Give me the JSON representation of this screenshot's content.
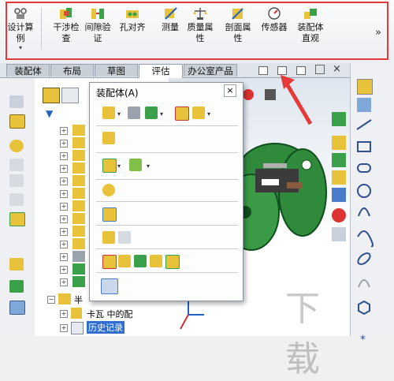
{
  "ribbon": {
    "buttons": [
      {
        "label": "设计算\n例",
        "icon": "design-study-icon"
      },
      {
        "label": "干涉检\n查",
        "icon": "interference-icon"
      },
      {
        "label": "间隙验\n证",
        "icon": "clearance-icon"
      },
      {
        "label": "孔对齐",
        "icon": "hole-align-icon"
      },
      {
        "label": "测量",
        "icon": "measure-icon"
      },
      {
        "label": "质量属\n性",
        "icon": "mass-properties-icon"
      },
      {
        "label": "剖面属\n性",
        "icon": "section-properties-icon"
      },
      {
        "label": "传感器",
        "icon": "sensor-icon"
      },
      {
        "label": "装配体\n直观",
        "icon": "assembly-visualization-icon"
      }
    ],
    "overflow": "»"
  },
  "tabs": [
    "装配体",
    "布局",
    "草图",
    "评估",
    "办公室产品"
  ],
  "active_tab": "评估",
  "popup": {
    "title": "装配体(A)",
    "close": "×"
  },
  "tree": {
    "items": [
      "半",
      "卡瓦 中的配",
      "历史记录"
    ]
  },
  "watermark": "下载"
}
